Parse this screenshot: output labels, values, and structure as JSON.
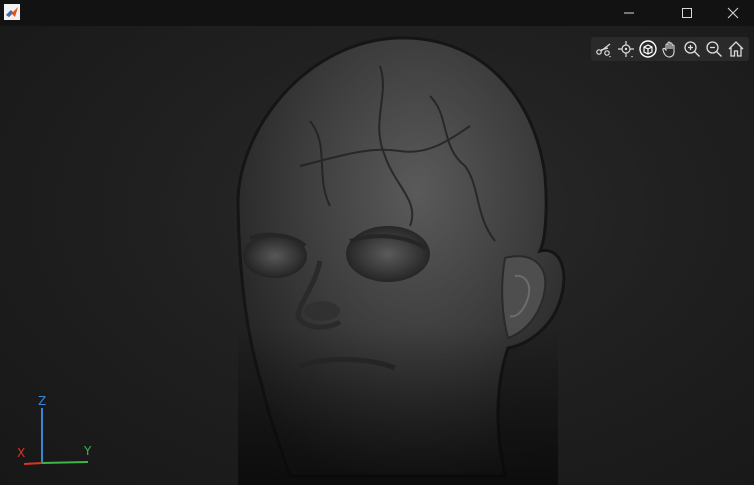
{
  "window": {
    "app_icon": "matlab-icon",
    "controls": [
      "minimize-icon",
      "maximize-icon",
      "close-icon"
    ]
  },
  "toolbar": {
    "tools": [
      "brush-icon",
      "datatip-icon",
      "rotate-3d-icon",
      "pan-hand-icon",
      "zoom-in-icon",
      "zoom-out-icon",
      "home-icon"
    ]
  },
  "axes_indicator": {
    "z": "Z",
    "x": "X",
    "y": "Y",
    "colors": {
      "x": "#d9342b",
      "y": "#3fb449",
      "z": "#3a86d6"
    }
  }
}
